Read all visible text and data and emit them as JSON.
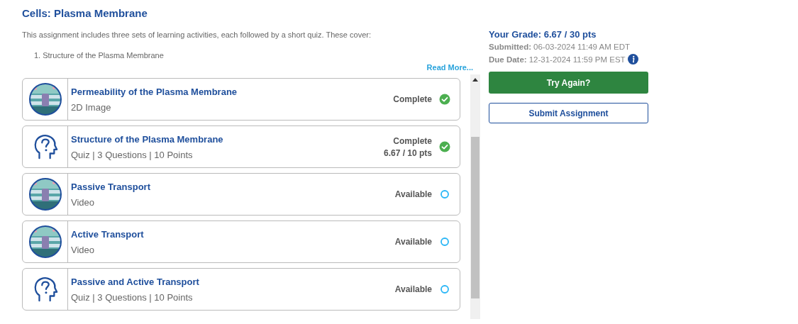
{
  "assignment": {
    "title": "Cells: Plasma Membrane",
    "description": "This assignment includes three sets of learning activities, each followed by a short quiz. These cover:",
    "topics": [
      "1. Structure of the Plasma Membrane"
    ],
    "read_more": "Read More..."
  },
  "activities": [
    {
      "kind": "picture",
      "title": "Permeability of the Plasma Membrane",
      "subtitle": "2D Image",
      "status": "Complete",
      "completed": true
    },
    {
      "kind": "quiz",
      "title": "Structure of the Plasma Membrane",
      "subtitle": "Quiz | 3 Questions | 10 Points",
      "status": "Complete",
      "score": "6.67 / 10 pts",
      "completed": true
    },
    {
      "kind": "picture",
      "title": "Passive Transport",
      "subtitle": "Video",
      "status": "Available",
      "completed": false
    },
    {
      "kind": "picture",
      "title": "Active Transport",
      "subtitle": "Video",
      "status": "Available",
      "completed": false
    },
    {
      "kind": "quiz",
      "title": "Passive and Active Transport",
      "subtitle": "Quiz | 3 Questions | 10 Points",
      "status": "Available",
      "completed": false
    }
  ],
  "grade": {
    "heading": "Your Grade: 6.67 / 30 pts",
    "submitted_label": "Submitted:",
    "submitted": "06-03-2024 11:49 AM EDT",
    "due_label": "Due Date:",
    "due": "12-31-2024 11:59 PM EST"
  },
  "buttons": [
    {
      "label": "Try Again?",
      "kind": "primary"
    },
    {
      "label": "Submit Assignment",
      "kind": "outline"
    }
  ]
}
